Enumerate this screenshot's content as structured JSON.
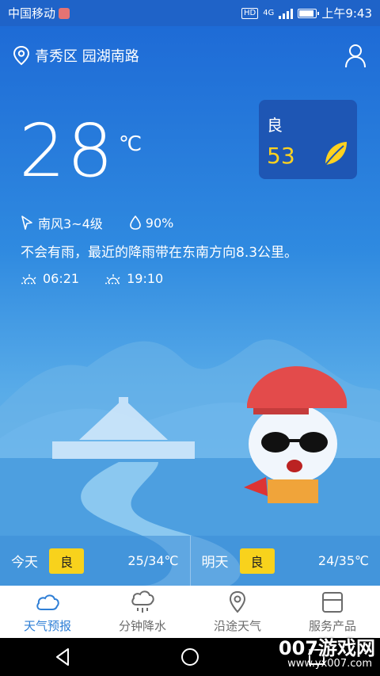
{
  "status_bar": {
    "carrier": "中国移动",
    "network": "4G",
    "hd": "HD",
    "time": "上午9:43"
  },
  "location": {
    "name": "青秀区 园湖南路",
    "icon": "location-pin-icon",
    "user_icon": "user-icon"
  },
  "current": {
    "temperature": "28",
    "unit": "℃",
    "wind": "南风3~4级",
    "humidity": "90%",
    "summary": "不会有雨，最近的降雨带在东南方向8.3公里。",
    "sunrise": "06:21",
    "sunset": "19:10"
  },
  "aqi": {
    "label": "良",
    "value": "53",
    "accent": "#ffd21f"
  },
  "forecast": [
    {
      "day": "今天",
      "quality": "良",
      "range": "25/34℃"
    },
    {
      "day": "明天",
      "quality": "良",
      "range": "24/35℃"
    }
  ],
  "tabs": [
    {
      "label": "天气预报",
      "icon": "cloud-icon",
      "active": true
    },
    {
      "label": "分钟降水",
      "icon": "rain-cloud-icon",
      "active": false
    },
    {
      "label": "沿途天气",
      "icon": "route-pin-icon",
      "active": false
    },
    {
      "label": "服务产品",
      "icon": "box-icon",
      "active": false
    }
  ],
  "watermark": {
    "brand": "007游戏网",
    "url": "www.yx007.com"
  },
  "colors": {
    "primary": "#1f63c8",
    "active_tab": "#2f7fd6",
    "badge": "#f8d21c"
  }
}
